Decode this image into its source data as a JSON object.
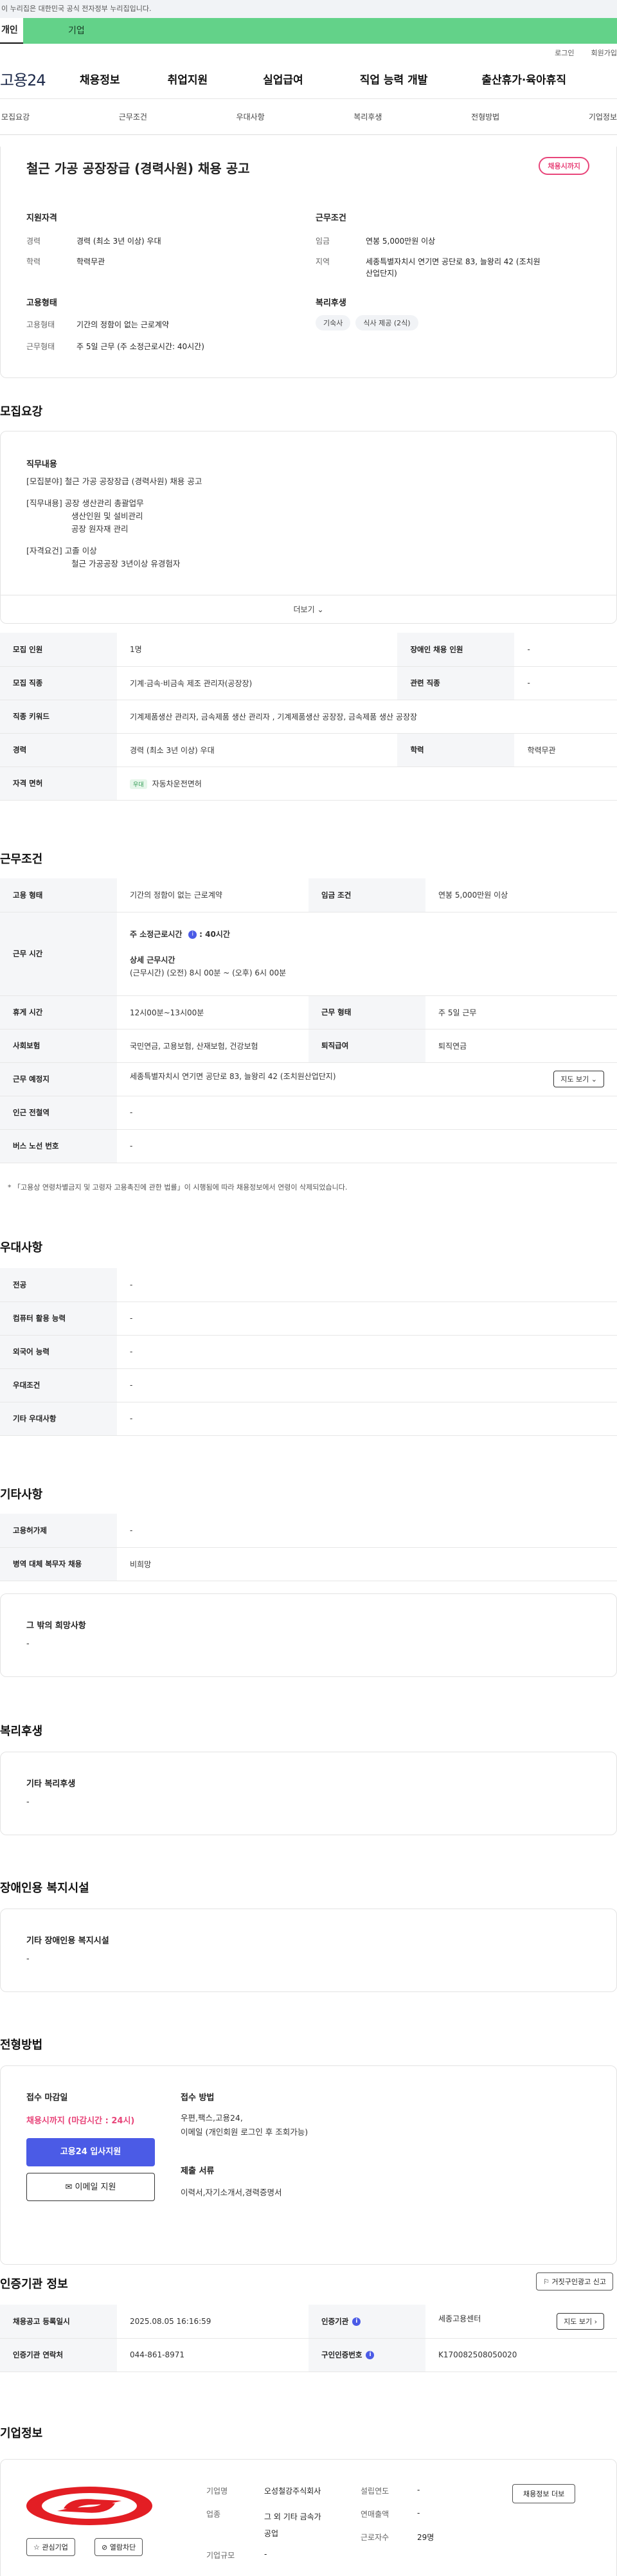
{
  "banner": {
    "text": "이 누리집은 대한민국 공식 전자정부 누리집입니다."
  },
  "top_tabs": {
    "personal": "개인",
    "corporate": "기업"
  },
  "util": {
    "login": "로그인",
    "join": "회원가입"
  },
  "gnb": {
    "logo": "고용24",
    "items": [
      "채용정보",
      "취업지원",
      "실업급여",
      "직업 능력 개발",
      "출산휴가·육아휴직"
    ]
  },
  "snb": {
    "items": [
      "모집요강",
      "근무조건",
      "우대사항",
      "복리후생",
      "전형방법",
      "기업정보"
    ]
  },
  "job": {
    "title": "철근 가공 공장장급 (경력사원) 채용 공고",
    "status": "채용시까지",
    "qual_heading": "지원자격",
    "career_label": "경력",
    "career_value": "경력 (최소 3년 이상) 우대",
    "edu_label": "학력",
    "edu_value": "학력무관",
    "cond_heading": "근무조건",
    "wage_label": "임금",
    "wage_value": "연봉 5,000만원 이상",
    "region_label": "지역",
    "region_value_1": "세종특별자치시 연기면 공단로 83, 늘왕리 42 (조치원",
    "region_value_2": "산업단지)",
    "type_heading": "고용형태",
    "type_label": "고용형태",
    "type_value": "기간의 정함이 없는 근로계약",
    "shift_label": "근무형태",
    "shift_value": "주 5일 근무 (주 소정근로시간: 40시간)",
    "welfare_heading": "복리후생",
    "welfare_chips": [
      "기숙사",
      "식사 제공 (2식)"
    ]
  },
  "summary": {
    "heading": "모집요강",
    "duty_heading": "직무내용",
    "lines": [
      "[모집분야] 철근 가공 공장장급 (경력사원) 채용 공고",
      "",
      "[직무내용] 공장 생산관리 총괄업무",
      "        생산인원 및 설비관리",
      "        공장 원자재 관리",
      "",
      "[자격요건] 고졸 이상",
      "        철근 가공공장 3년이상 유경험자"
    ],
    "more": "더보기"
  },
  "recruit_table": [
    [
      "모집 인원",
      "1명",
      "장애인 채용 인원",
      "-"
    ],
    [
      "모집 직종",
      "기계·금속·비금속 제조 관리자(공장장)",
      "관련 직종",
      "-"
    ],
    [
      "직종 키워드",
      "기계제품생산 관리자, 금속제품 생산 관리자 , 기계제품생산 공장장, 금속제품 생산 공장장",
      "",
      ""
    ],
    [
      "경력",
      "경력 (최소 3년 이상) 우대",
      "학력",
      "학력무관"
    ]
  ],
  "license": {
    "label": "자격 면허",
    "badge": "우대",
    "value": "자동차운전면허"
  },
  "conditions": {
    "heading": "근무조건",
    "type_label": "고용 형태",
    "type_value": "기간의 정함이 없는 근로계약",
    "wage_label": "임금 조건",
    "wage_value": "연봉 5,000만원 이상",
    "hours_label": "근무 시간",
    "hours_main_prefix": "주 소정근로시간",
    "hours_main_value": ": 40시간",
    "hours_detail_title": "상세 근무시간",
    "hours_detail_value": "(근무시간) (오전) 8시 00분 ~ (오후) 6시 00분",
    "rest_label": "휴게 시간",
    "rest_value": "12시00분~13시00분",
    "shift_label": "근무 형태",
    "shift_value": "주 5일 근무",
    "insurance_label": "사회보험",
    "insurance_value": "국민연금, 고용보험, 산재보험, 건강보험",
    "severance_label": "퇴직급여",
    "severance_value": "퇴직연금",
    "place_label": "근무 예정지",
    "place_value": "세종특별자치시 연기면 공단로 83, 늘왕리 42 (조치원산업단지)",
    "map_btn": "지도 보기",
    "station_label": "인근 전철역",
    "station_value": "-",
    "bus_label": "버스 노선 번호",
    "bus_value": "-",
    "note": "* 「고용상 연령차별금지 및 고령자 고용촉진에 관한 법률」이 시행됨에 따라 채용정보에서 연령이 삭제되었습니다."
  },
  "preference": {
    "heading": "우대사항",
    "rows": [
      [
        "전공",
        "-"
      ],
      [
        "컴퓨터 활용 능력",
        "-"
      ],
      [
        "외국어 능력",
        "-"
      ],
      [
        "우대조건",
        "-"
      ],
      [
        "기타 우대사항",
        "-"
      ]
    ]
  },
  "etc": {
    "heading": "기타사항",
    "rows": [
      [
        "고용허가제",
        "-"
      ],
      [
        "병역 대체 복무자 채용",
        "비희망"
      ]
    ],
    "other_title": "그 밖의 희망사항",
    "other_value": "-"
  },
  "welfare": {
    "heading": "복리후생",
    "title": "기타 복리후생",
    "value": "-"
  },
  "disabled": {
    "heading": "장애인용 복지시설",
    "title": "기타 장애인용 복지시설",
    "value": "-"
  },
  "apply": {
    "heading": "전형방법",
    "deadline_title": "접수 마감일",
    "deadline_value": "채용시까지 (마감시간 : 24시)",
    "apply_btn": "고용24 입사지원",
    "email_btn": "이메일 지원",
    "method_title": "접수 방법",
    "method_value_1": "우편,팩스,고용24,",
    "method_value_2": "이메일 (개인회원 로그인 후 조회가능)",
    "docs_title": "제출 서류",
    "docs_value": "이력서,자기소개서,경력증명서"
  },
  "cert": {
    "heading": "인증기관 정보",
    "report_btn": "거짓구인광고 신고",
    "reg_label": "채용공고 등록일시",
    "reg_value": "2025.08.05 16:16:59",
    "org_label": "인증기관",
    "org_value": "세종고용센터",
    "map_btn": "지도 보기",
    "contact_label": "인증기관 연락처",
    "contact_value": "044-861-8971",
    "offer_label": "구인인증번호",
    "offer_value": "K170082508050020"
  },
  "company": {
    "heading": "기업정보",
    "interest_btn": "관심기업",
    "block_btn": "열람차단",
    "name_label": "기업명",
    "name_value": "오성철강주식회사",
    "industry_label": "업종",
    "industry_value_1": "그 외 기타 금속가",
    "industry_value_2": "공업",
    "size_label": "기업규모",
    "size_value": "-",
    "founded_label": "설립연도",
    "founded_value": "-",
    "revenue_label": "연매출액",
    "revenue_value": "-",
    "staff_label": "근로자수",
    "staff_value": "29명",
    "more_btn": "채용정보 더보"
  },
  "colors": {
    "accent": "#4b5be6",
    "badge": "#e8457a",
    "corp_tab": "#63d289",
    "logo_red": "#e31e24"
  }
}
